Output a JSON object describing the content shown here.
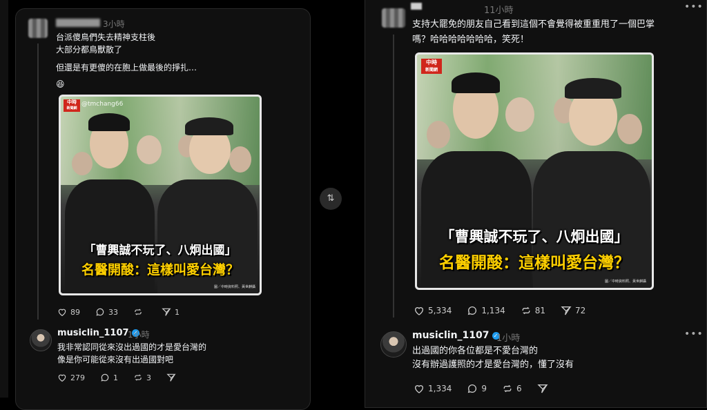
{
  "left": {
    "post": {
      "time": "3小時",
      "lines": [
        "台派傻鳥們失去精神支柱後",
        "大部分都鳥獸散了",
        "但還是有更傻的在胞上做最後的掙扎…"
      ],
      "emoji": "😆",
      "watermark": "@tmchang66",
      "caption1": "「曹興誠不玩了、八炯出國」",
      "caption2": "名醫開酸：這樣叫愛台灣？",
      "credit": "圖／中時資料照、黃世麒攝",
      "logo_top": "中時",
      "logo_bottom": "新聞網",
      "likes": "89",
      "comments": "33",
      "shares": "1"
    },
    "reply": {
      "username": "musiclin_1107",
      "time": "1小時",
      "lines": [
        "我非常認同從來沒出過國的才是愛台灣的",
        "像是你可能從來沒有出過國對吧"
      ],
      "likes": "279",
      "comments": "1",
      "reposts": "3"
    }
  },
  "right": {
    "post": {
      "time": "11小時",
      "lines": [
        "支持大罷免的朋友自己看到這個不會覺得被重重甩了一個巴掌",
        "嗎？哈哈哈哈哈哈哈，笑死！"
      ],
      "caption1": "「曹興誠不玩了、八炯出國」",
      "caption2": "名醫開酸：這樣叫愛台灣？",
      "credit": "圖／中時資料照、黃世麒攝",
      "logo_top": "中時",
      "logo_bottom": "新聞網",
      "likes": "5,334",
      "comments": "1,134",
      "reposts": "81",
      "shares": "72"
    },
    "reply": {
      "username": "musiclin_1107",
      "time": "1小時",
      "lines": [
        "出過國的你各位都是不愛台灣的",
        "沒有辦過護照的才是愛台灣的，懂了沒有"
      ],
      "likes": "1,334",
      "comments": "9",
      "reposts": "6"
    }
  },
  "center": {
    "icon": "repost-icon"
  },
  "colors": {
    "bg": "#000000",
    "panel": "#101010",
    "caption_yellow": "#ffd000",
    "badge_blue": "#1d9bf0",
    "logo_red": "#d0261c"
  }
}
